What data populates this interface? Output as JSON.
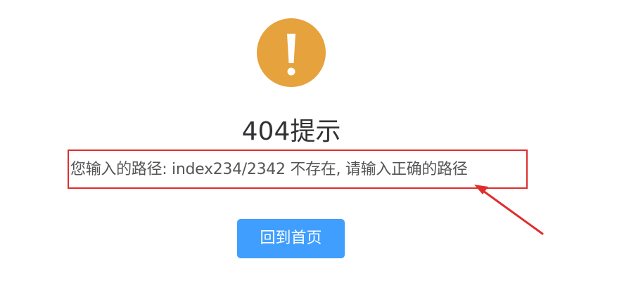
{
  "icon": "warning-exclamation-icon",
  "title": "404提示",
  "message": "您输入的路径: index234/2342 不存在, 请输入正确的路径",
  "home_button_label": "回到首页",
  "colors": {
    "warning": "#e6a23c",
    "primary": "#409eff",
    "annotation": "#e02d2d",
    "title_text": "#303133",
    "message_text": "#555555"
  }
}
